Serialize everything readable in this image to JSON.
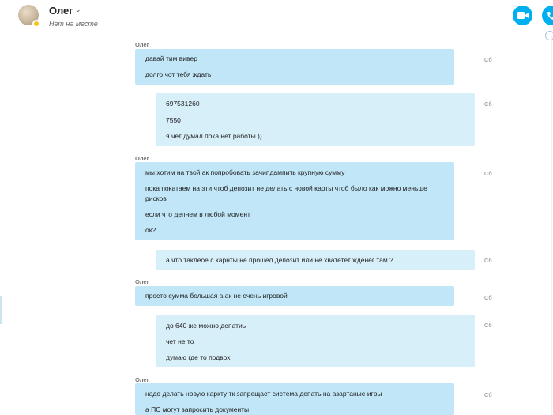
{
  "header": {
    "contact_name": "Олег",
    "contact_status": "Нет на месте",
    "chevron": "⌄",
    "avatar_status_color": "#f5c518",
    "accent_color": "#00aff0"
  },
  "messages": [
    {
      "sender": "Олег",
      "time": "Сб",
      "lines": [
        "давай тим вивер",
        "долго чот тебя ждать"
      ]
    },
    {
      "sender": "",
      "time": "Сб",
      "lines": [
        "697531260",
        "7550",
        "я чет думал пока нет работы  ))"
      ]
    },
    {
      "sender": "Олег",
      "time": "Сб",
      "lines": [
        "мы хотим на твой ак попробовать зачипдампить крупную сумму",
        "пока покатаем на эти чтоб депозит не делать с новой карты чтоб было как можно меньше",
        "рисков",
        "если что депнем в любой момент",
        "ок?"
      ]
    },
    {
      "sender": "",
      "time": "Сб",
      "lines": [
        "а что таклеое с карнты не прошел депозит или не хватетет жденег там ?"
      ]
    },
    {
      "sender": "Олег",
      "time": "Сб",
      "lines": [
        "просто сумма большая а ак не очень игровой"
      ]
    },
    {
      "sender": "",
      "time": "Сб",
      "lines": [
        "до  640  же можно депатиь",
        "чет не то",
        "думаю где то подвох"
      ]
    },
    {
      "sender": "Олег",
      "time": "Сб",
      "lines": [
        "надо делать новую каркту тк запрещает система депать на азартаные игры",
        "а ПС могут запросить документы"
      ]
    }
  ],
  "icons": {
    "video": "video-camera-icon",
    "call": "phone-icon",
    "globe": "globe-icon"
  }
}
